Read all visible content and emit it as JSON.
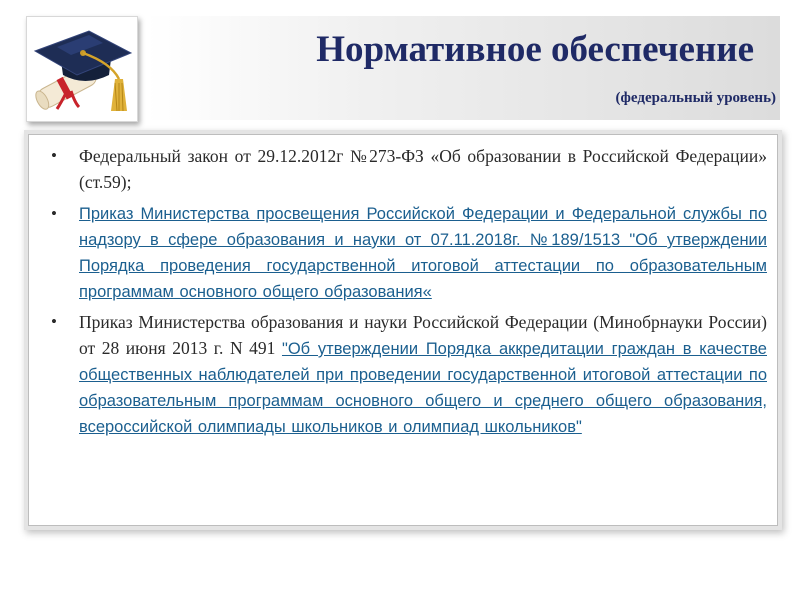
{
  "header": {
    "title": "Нормативное обеспечение",
    "subtitle": "(федеральный уровень)",
    "logo_icon": "graduation-cap-icon"
  },
  "colors": {
    "title": "#1f2a66",
    "link_teal": "#1b5f8f",
    "link_blue": "#1d4f86",
    "body_text": "#2a2a2a"
  },
  "items": [
    {
      "text": "Федеральный закон от 29.12.2012г №273-ФЗ «Об образовании в Российской Федерации» (ст.59);"
    },
    {
      "link": " Приказ Министерства просвещения Российской Федерации и Федеральной службы по надзору в сфере образования и науки от 07.11.2018г. №189/1513 \"Об утверждении Порядка проведения государственной итоговой аттестации по образовательным программам основного общего образования«"
    },
    {
      "text": "Приказ Министерства образования и науки Российской Федерации (Минобрнауки России) от 28 июня 2013 г. N 491 ",
      "link": "\"Об утверждении Порядка аккредитации граждан в качестве общественных наблюдателей при проведении государственной итоговой аттестации по образовательным программам основного общего и среднего общего образования, всероссийской олимпиады школьников и олимпиад школьников\""
    }
  ]
}
